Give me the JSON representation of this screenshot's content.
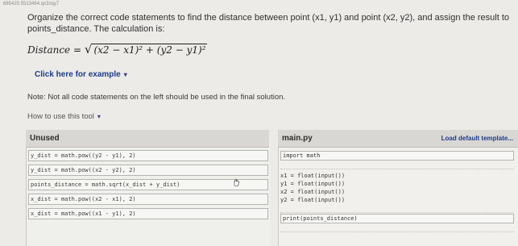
{
  "header_id": "685420.5513464.qx3zqy7",
  "instructions": "Organize the correct code statements to find the distance between point (x1, y1) and point (x2, y2), and assign the result to points_distance. The calculation is:",
  "formula": {
    "lhs": "Distance",
    "eq": "=",
    "radical": "√",
    "radicand": "(x2 − x1)² + (y2 − y1)²"
  },
  "example_link": "Click here for example",
  "note": "Note: Not all code statements on the left should be used in the final solution.",
  "how_to": "How to use this tool",
  "unused": {
    "title": "Unused",
    "blocks": [
      "y_dist = math.pow((y2 - y1), 2)",
      "y_dist = math.pow((x2 - y2), 2)",
      "points_distance = math.sqrt(x_dist + y_dist)",
      "x_dist = math.pow((x2 - x1), 2)",
      "x_dist = math.pow((x1 - y1), 2)"
    ]
  },
  "main": {
    "title": "main.py",
    "load_template": "Load default template...",
    "lines": [
      "import math",
      "x1 = float(input())",
      "y1 = float(input())",
      "x2 = float(input())",
      "y2 = float(input())",
      "print(points_distance)"
    ]
  }
}
